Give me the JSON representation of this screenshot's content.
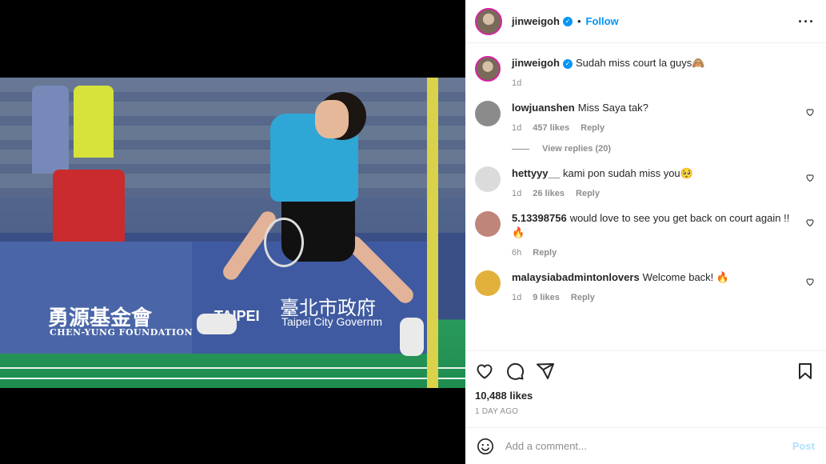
{
  "post": {
    "username": "jinweigoh",
    "follow_label": "Follow",
    "separator": "•",
    "more_icon": "more-horizontal-icon",
    "caption_user": "jinweigoh",
    "caption_text": "Sudah miss court la guys🙈",
    "caption_time": "1d"
  },
  "media": {
    "banner_left_cn": "勇源基金會",
    "banner_left_en": "CHEN-YUNG FOUNDATION",
    "banner_right_cn": "臺北市政府",
    "banner_right_en": "Taipei City Governm",
    "banner_right_logo": "TAIPEI"
  },
  "comments": [
    {
      "user": "lowjuanshen",
      "text": "Miss Saya tak?",
      "time": "1d",
      "likes": "457 likes",
      "reply": "Reply",
      "avatar_color": "#8b8b8b"
    },
    {
      "user": "hettyyy__",
      "text": "kami pon sudah miss you🥺",
      "time": "1d",
      "likes": "26 likes",
      "reply": "Reply",
      "avatar_color": "#dbdbdb"
    },
    {
      "user": "5.13398756",
      "text": "would love to see you get back on court again !! 🔥",
      "time": "6h",
      "likes": "",
      "reply": "Reply",
      "avatar_color": "#c0857a"
    },
    {
      "user": "malaysiabadmintonlovers",
      "text": "Welcome back! 🔥",
      "time": "1d",
      "likes": "9 likes",
      "reply": "Reply",
      "avatar_color": "#e2b13c"
    }
  ],
  "view_replies": "View replies (20)",
  "actions": {
    "likes": "10,488 likes",
    "time": "1 DAY AGO"
  },
  "add_comment": {
    "placeholder": "Add a comment...",
    "post_label": "Post"
  },
  "colors": {
    "accent": "#0095f6",
    "text": "#262626",
    "muted": "#8e8e8e"
  }
}
